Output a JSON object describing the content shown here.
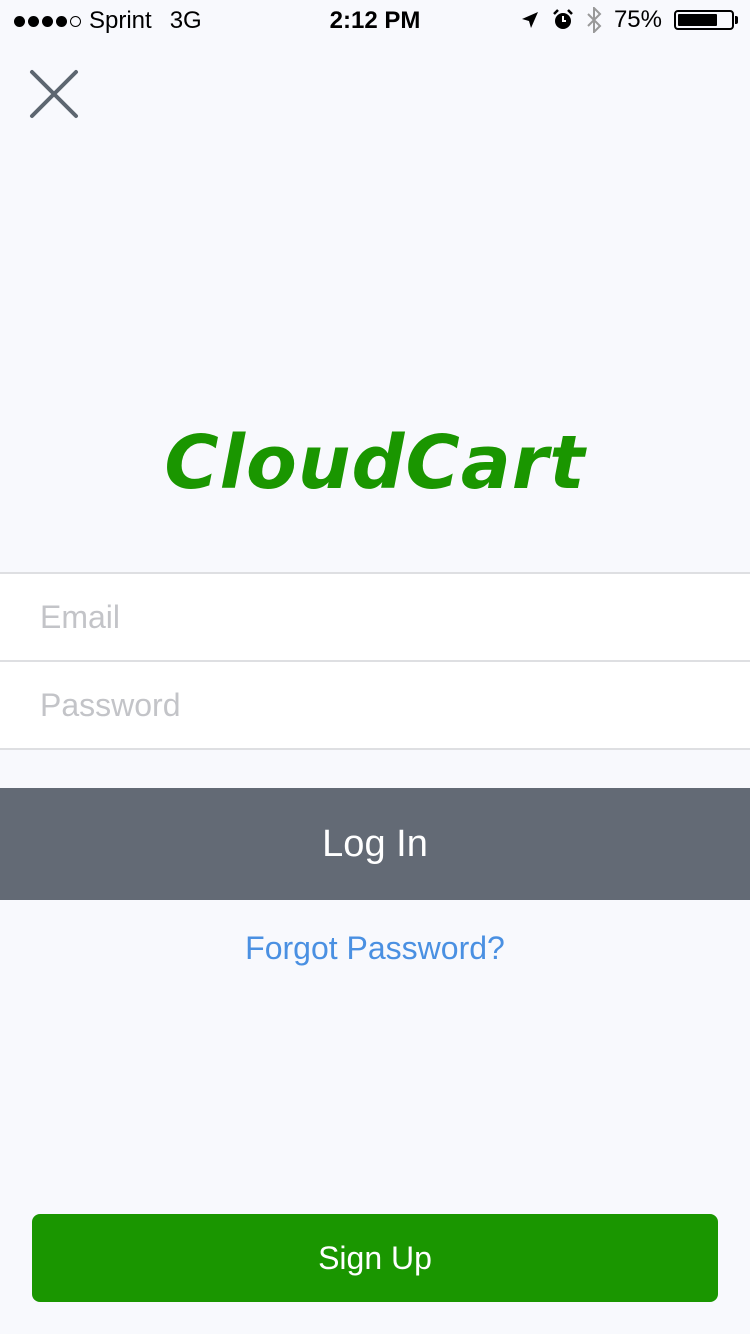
{
  "status_bar": {
    "carrier": "Sprint",
    "network": "3G",
    "time": "2:12 PM",
    "battery_percent": "75%",
    "battery_level": 0.75,
    "icons": [
      "location-arrow-icon",
      "alarm-icon",
      "bluetooth-icon",
      "battery-icon"
    ]
  },
  "header": {
    "close_icon": "close-icon"
  },
  "logo": {
    "text": "CloudCart",
    "color": "#1a9600"
  },
  "form": {
    "email_placeholder": "Email",
    "email_value": "",
    "password_placeholder": "Password",
    "password_value": ""
  },
  "actions": {
    "login_label": "Log In",
    "forgot_label": "Forgot Password?",
    "signup_label": "Sign Up"
  },
  "colors": {
    "background": "#f8f9fd",
    "login_button": "#636a75",
    "signup_button": "#1a9600",
    "link": "#4a90e2"
  }
}
